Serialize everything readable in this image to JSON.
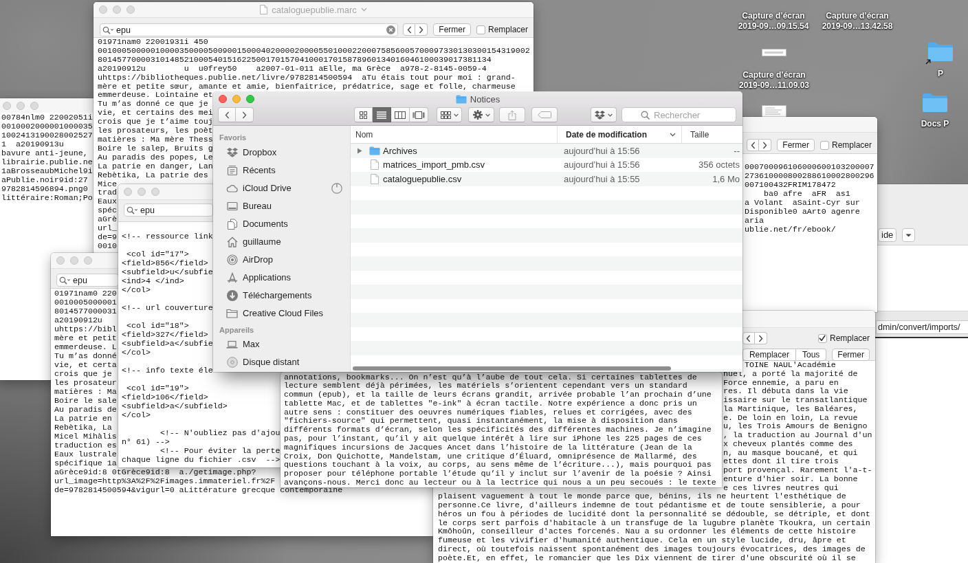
{
  "desktop": {
    "icons": [
      {
        "kind": "screenshot",
        "label": "Capture d’écran 2019-09…09.15.54"
      },
      {
        "kind": "screenshot",
        "label": "Capture d’écran 2019-09…13.42.58"
      },
      {
        "kind": "screenshot",
        "label": "Capture d’écran 2019-09…11.09.03"
      },
      {
        "kind": "document"
      },
      {
        "kind": "folder",
        "label": "P",
        "alias": true
      },
      {
        "kind": "folder",
        "label": "Docs P",
        "alias": false
      }
    ]
  },
  "windows": [
    {
      "kind": "app",
      "toolbar_button": "ide",
      "path_field": "dmin/convert/imports/"
    },
    {
      "kind": "editor",
      "title_bar": {
        "active": false
      },
      "lines": [
        "00784nlm0 22002051i",
        "0010002000001000035",
        "1002413190028002527",
        "1  a20190913u",
        "bavure anti-jeune,",
        "librairie.publie.ne",
        "1aBrosseaubMichel9i",
        "aPublie.noir9id:27",
        "9782814596894.png0",
        "littéraire:Roman;Po"
      ]
    },
    {
      "kind": "editor",
      "title_bar": {
        "active": false,
        "title": "cataloguepublie.marc"
      },
      "find_bar": {
        "query": "epu",
        "clear_button": true,
        "navigation": true,
        "close_label": "Fermer",
        "replace": {
          "label": "Remplacer",
          "checked": false
        }
      },
      "lines": [
        "01971nam0 22001931i 450",
        "001000500000100003500005009001500040200002000055010002200075856005700097330130300154319002",
        "8014577000031014852100054015162250017015704100017015878960134016046100039017381134",
        "a20190912u        u  u0frey50    a2007-01-011 aElle, ma Grèce  a978-2-8145-0059-4",
        "uhttps://bibliotheques.publie.net/livre/9782814500594  aTu étais tout pour moi : grand-",
        "mère et petite sœur, amante et amie, bienfaitrice, prédatrice, sage et folle, charmeuse",
        "emmerdeuse. Lointaine et",
        "Tu m’as donné ce que je",
        "vie, et certains des mei",
        "crois que je t’aime touj",
        "les prosateurs, les poèt",
        "matières : Ma mère Thess",
        "Boire le salep, Bruits g",
        "Au paradis des popes, Le",
        "La patrie en danger, Lan",
        "Rebètika, La patrie des",
        "Mice",
        "trad",
        "Eaux",
        "spéc",
        "aGrè",
        "url_",
        "de=9",
        "0010"
      ]
    },
    {
      "kind": "editor",
      "find_bar": {
        "navigation": true,
        "close_label": "Fermer",
        "replace": {
          "label": "Remplacer",
          "checked": false
        }
      },
      "lines": [
        "000700096106000600103200007",
        "273610000800288610002800296",
        "007100432FRIM178472",
        "    ba0 afre  aFR  as1",
        "a Volant  aSaint-Cyr sur",
        "Disponible0 aArt0 agenre",
        "aria",
        "ublie.net/fr/ebook/"
      ]
    },
    {
      "kind": "editor",
      "title_bar": {
        "active": false
      },
      "find_bar": {
        "query": "epu"
      },
      "lines": [
        "01971nam0 220",
        "0010005000001",
        "8014577000031",
        "a20190912u",
        "uhttps://bibl",
        "mère et petit",
        "emmerdeuse. L",
        "Tu m’as donné",
        "vie, et certa",
        "crois que je",
        "les prosateur",
        "matières : Ma",
        "Boire le sale",
        "Au paradis de",
        "La patrie en",
        "Rebètika, La",
        "Micel Mihàlis",
        "traduction es",
        "Eaux lustrale",
        "spécifique 1a",
        "aGrèce9id:8 0tGrèce9id:8  a./getimage.php?",
        "url_image=http%3A%2F%2Fimages.immateriel.fr%2F",
        "de=9782814500594&vigurl=0 aLittérature grecque contemporaine"
      ]
    },
    {
      "kind": "editor",
      "title_bar": {
        "active": false
      },
      "find_bar": {
        "query": "epu"
      },
      "blocks": [
        [
          "<!-- ressource link"
        ],
        [
          " <col id=\"17\">",
          "<field>856</field>",
          "<subfield>u</subfie",
          "<ind>4 </ind>",
          "</col>"
        ],
        [
          "<!-- url couverture"
        ],
        [
          " <col id=\"18\">",
          "<field>327</field>",
          "<subfield>a</subfie",
          "</col>"
        ],
        [
          "<!-- info texte éle"
        ],
        [
          " <col id=\"19\">",
          "<field>106</field>",
          "<subfield>a</subfield>",
          "</col>"
        ],
        [
          "        <!-- N'oubliez pas d'ajou",
          "n° 61) -->",
          "        <!-- Pour éviter la perte",
          "chaque ligne du fichier .csv  -->"
        ]
      ]
    },
    {
      "kind": "editor",
      "find_bar": {
        "navigation": true,
        "close_label": "Fermer",
        "replace": {
          "label": "Remplacer",
          "checked": true
        },
        "replace_buttons": [
          "Remplacer",
          "Tous"
        ]
      },
      "line_ends": [
        "TOINE NAUL'Académie",
        "nuel, a porté la majorité de",
        "Force ennemie, a paru en",
        "res. Il débuta dans la vie",
        "issaire sur le transatlantique",
        "la Martinique, les Baléares,",
        "e. De loin en loin, La revue",
        "u, les Trois Amours de Benigno",
        ", la traduction au Journal d'un",
        "x cheveux plantés comme des",
        "n, au masque boucané, et qui",
        "ettes dont il tire trois",
        "port provençal. Rarement l'a-t-",
        "enture d'hier soir. La bonne",
        "e ces livres neutres qui"
      ],
      "lines": [
        "plaisent vaguement à tout le monde parce que, bénins, ils ne heurtent l'esthétique de",
        "personne.Ce livre, d'ailleurs indemne de tout pédantisme et de toute sensiblerie, a pour",
        "héros un fou à périodes de lucidité dont la personnalité se dédouble, se détriple, et dont",
        "le corps sert parfois d'habitacle à un transfuge de la lugubre planète Tkoukra, un certain",
        "Kmôhoûn, conseilleur d'actes forcenés. Nau a su ordonner les éléments de cette histoire",
        "fumeuse et les vivifier d'humanité authentique. Cela en un style lucide, dru, âpre et",
        "direct, où toutefois naissent spontanément des images toujours évocatrices, des images de",
        "poète.Et, en effet, le romancier que les Dix viennent de tirer d'une obscurité où il se"
      ]
    },
    {
      "kind": "editor",
      "lines": [
        "annotations, bookmarks... On n’est qu’à l’aube de tout cela. Si certaines tablettes de",
        "lecture semblent déjà périmées, les matériels s’orientent cependant vers un standard",
        "commun (epub), et la taille de leurs écrans grandit, arrivée probable l’an prochain d’une",
        "tablette Mac, et de tablettes \"e-ink\" à écran tactile. Notre expérience a donc pris un",
        "autre sens : constituer des oeuvres numériques fiables, relues et corrigées, avec des",
        "\"fichiers-source\" qui permettent, quasi instantanément, la mise à disposition dans",
        "différents formats d’écran, selon les spécificités des différentes machines. Je n’imagine",
        "pas, pour l’instant, qu’il y ait quelque intérêt à lire sur iPhone les 225 pages de ces",
        "magnifiques incursions de Jacques Ancet dans l’histoire de la littérature (Jean de la",
        "Croix, Don Quichotte, Mandelstam, une critique d’Éluard, omniprésence de Mallarmé, des",
        "questions touchant à la voix, au corps, au sens même de l’écriture...), mais pourquoi pas",
        "proposer pour téléphone portable l’étude qu’il y inclut sur l’avenir de la poésie ? Ainsi",
        "avançons-nous. Merci donc au lecteur ou à la lectrice qui nous a un peu secoués : le texte"
      ]
    },
    {
      "kind": "finder",
      "title_bar": {
        "active": true,
        "title": "Notices"
      },
      "toolbar": {
        "view_modes": [
          {
            "kind": "icons",
            "selected": false
          },
          {
            "kind": "list",
            "selected": true
          },
          {
            "kind": "columns",
            "selected": false
          },
          {
            "kind": "gallery",
            "selected": false
          }
        ],
        "search_placeholder": "Rechercher"
      },
      "sidebar": {
        "sections": [
          {
            "title": "Favoris",
            "items": [
              {
                "kind": "dropbox",
                "label": "Dropbox",
                "selected": false,
                "syncing": false
              },
              {
                "kind": "recents",
                "label": "Récents",
                "selected": false,
                "syncing": false
              },
              {
                "kind": "cloud",
                "label": "iCloud Drive",
                "selected": false,
                "syncing": true
              },
              {
                "kind": "desktop",
                "label": "Bureau",
                "selected": false,
                "syncing": false
              },
              {
                "kind": "documents",
                "label": "Documents",
                "selected": false,
                "syncing": false
              },
              {
                "kind": "home",
                "label": "guillaume",
                "selected": false,
                "syncing": false
              },
              {
                "kind": "airdrop",
                "label": "AirDrop",
                "selected": false,
                "syncing": false
              },
              {
                "kind": "applications",
                "label": "Applications",
                "selected": false,
                "syncing": false
              },
              {
                "kind": "downloads",
                "label": "Téléchargements",
                "selected": false,
                "syncing": false
              },
              {
                "kind": "folder",
                "label": "Creative Cloud Files",
                "selected": false,
                "syncing": false
              }
            ]
          },
          {
            "title": "Appareils",
            "items": [
              {
                "kind": "laptop",
                "label": "Max",
                "selected": false,
                "syncing": false
              },
              {
                "kind": "disk",
                "label": "Disque distant",
                "selected": false,
                "syncing": false
              }
            ]
          }
        ]
      },
      "file_list": {
        "columns": [
          {
            "label": "Nom",
            "sorted": false
          },
          {
            "label": "Date de modification",
            "sorted": true
          },
          {
            "label": "Taille",
            "sorted": false
          }
        ],
        "rows": [
          {
            "kind": "folder",
            "name": "Archives",
            "expanded": false,
            "date": "aujourd’hui à 15:56",
            "size": "--",
            "selected": false
          },
          {
            "kind": "file",
            "name": "matrices_import_pmb.csv",
            "date": "aujourd’hui à 15:56",
            "size": "356 octets",
            "selected": false
          },
          {
            "kind": "file",
            "name": "cataloguepublie.csv",
            "date": "aujourd’hui à 15:55",
            "size": "1,6 Mo",
            "selected": false
          }
        ]
      }
    }
  ]
}
